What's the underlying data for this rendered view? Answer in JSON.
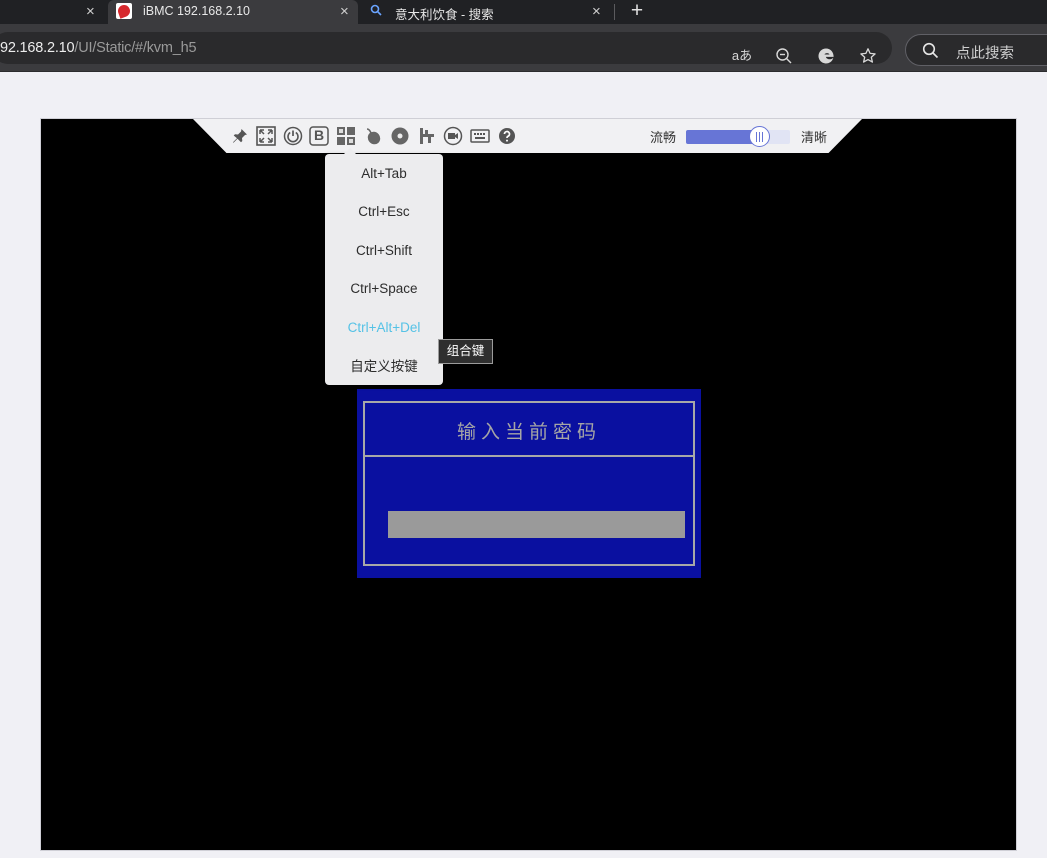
{
  "browser": {
    "tabs": [
      {
        "title": "",
        "close": "×"
      },
      {
        "title": "iBMC 192.168.2.10",
        "close": "×",
        "favicon": "ibmc-favicon"
      },
      {
        "title": "意大利饮食 - 搜索",
        "close": "×",
        "favicon": "search-favicon"
      }
    ],
    "new_tab": "+",
    "url_host": "92.168.2.10",
    "url_path": "/UI/Static/#/kvm_h5",
    "toolbar_icons": [
      "read-aloud-icon",
      "zoom-out-icon",
      "edge-icon",
      "favorite-star-icon"
    ],
    "read_aloud": "aあ",
    "search_placeholder": "点此搜索"
  },
  "kvm": {
    "toolbar": {
      "icons": [
        "pin-icon",
        "fullscreen-icon",
        "power-icon",
        "bold-b-icon",
        "key-combination-icon",
        "mouse-icon",
        "disc-icon",
        "usb-icon",
        "record-icon",
        "keyboard-icon",
        "help-icon"
      ],
      "b_label": "B",
      "quality_low_label": "流畅",
      "quality_high_label": "清晰",
      "quality_value_percent": 70
    },
    "combo_menu": {
      "items": [
        "Alt+Tab",
        "Ctrl+Esc",
        "Ctrl+Shift",
        "Ctrl+Space",
        "Ctrl+Alt+Del",
        "自定义按键"
      ],
      "active_index": 4,
      "active_color": "#55c2e6"
    },
    "tooltip": "组合键",
    "bios_dialog": {
      "title": "输入当前密码",
      "background_color": "#0a10a0"
    }
  }
}
